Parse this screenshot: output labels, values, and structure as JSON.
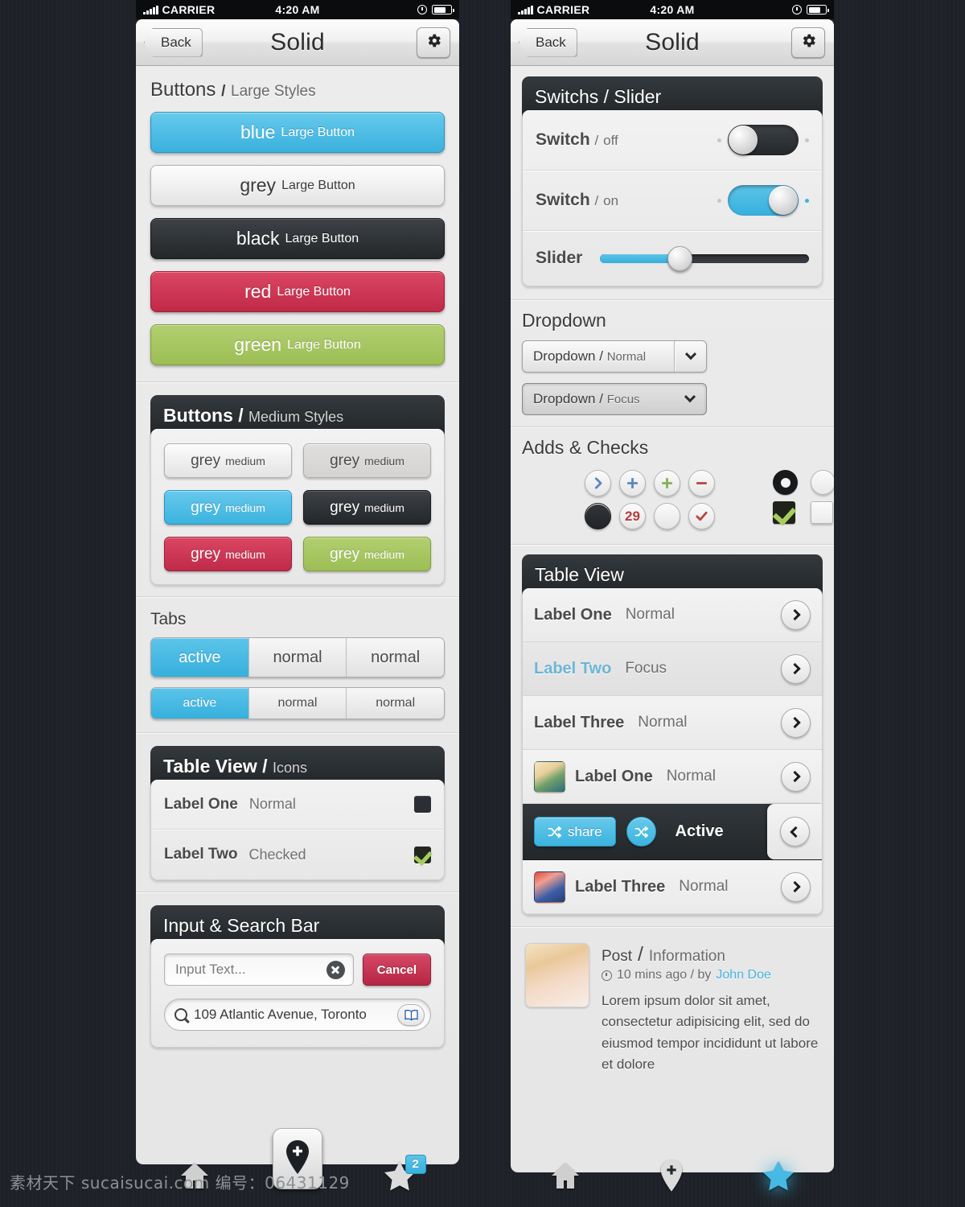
{
  "statusbar": {
    "carrier": "CARRIER",
    "time": "4:20 AM"
  },
  "navbar": {
    "back": "Back",
    "title": "Solid",
    "gear_icon": "gear-icon"
  },
  "left": {
    "buttons_large": {
      "heading_main": "Buttons",
      "heading_sep": "/",
      "heading_sub": "Large Styles",
      "items": [
        {
          "color_word": "blue",
          "label": "Large Button",
          "accent": "#39b1dd"
        },
        {
          "color_word": "grey",
          "label": "Large Button",
          "accent": "#e4e4e4"
        },
        {
          "color_word": "black",
          "label": "Large Button",
          "accent": "#242729"
        },
        {
          "color_word": "red",
          "label": "Large Button",
          "accent": "#c02a48"
        },
        {
          "color_word": "green",
          "label": "Large Button",
          "accent": "#9cbe55"
        }
      ]
    },
    "buttons_medium": {
      "heading_main": "Buttons",
      "heading_sep": "/",
      "heading_sub": "Medium Styles",
      "items": [
        {
          "color_word": "grey",
          "label": "medium"
        },
        {
          "color_word": "grey",
          "label": "medium"
        },
        {
          "color_word": "grey",
          "label": "medium"
        },
        {
          "color_word": "grey",
          "label": "medium"
        },
        {
          "color_word": "grey",
          "label": "medium"
        },
        {
          "color_word": "grey",
          "label": "medium"
        }
      ]
    },
    "tabs": {
      "heading": "Tabs",
      "row1": [
        "active",
        "normal",
        "normal"
      ],
      "row2": [
        "active",
        "normal",
        "normal"
      ]
    },
    "table_icons": {
      "heading_main": "Table View",
      "heading_sep": "/",
      "heading_sub": "Icons",
      "rows": [
        {
          "label": "Label One",
          "value": "Normal",
          "icon": "square-dark-icon"
        },
        {
          "label": "Label Two",
          "value": "Checked",
          "icon": "checkbox-checked-icon"
        }
      ]
    },
    "input_search": {
      "heading": "Input & Search Bar",
      "input_placeholder": "Input Text...",
      "clear_icon": "clear-circle-icon",
      "cancel_label": "Cancel",
      "search_value": "109 Atlantic Avenue, Toronto",
      "search_icon": "search-icon",
      "book_icon": "bookmark-book-icon"
    },
    "tabbar": [
      {
        "icon": "home-icon",
        "badge": ""
      },
      {
        "icon": "pin-plus-icon",
        "badge": ""
      },
      {
        "icon": "star-icon",
        "badge": "2"
      }
    ]
  },
  "right": {
    "switches": {
      "heading": "Switchs / Slider",
      "rows": [
        {
          "label": "Switch",
          "sep": "/",
          "state": "off"
        },
        {
          "label": "Switch",
          "sep": "/",
          "state": "on"
        }
      ],
      "slider_label": "Slider",
      "slider_percent": 38
    },
    "dropdown": {
      "heading": "Dropdown",
      "items": [
        {
          "label": "Dropdown",
          "sep": "/",
          "state": "Normal"
        },
        {
          "label": "Dropdown",
          "sep": "/",
          "state": "Focus"
        }
      ]
    },
    "adds_checks": {
      "heading": "Adds & Checks",
      "left_icons": [
        "chevron-right-circle-icon",
        "plus-blue-circle-icon",
        "plus-green-circle-icon",
        "minus-red-circle-icon",
        "solid-dark-circle-icon",
        "badge-29-icon",
        "empty-circle-icon",
        "check-red-circle-icon"
      ],
      "badge_number": "29",
      "right_icons": [
        "radio-selected-icon",
        "radio-unselected-icon",
        "checkbox-checked-icon",
        "checkbox-unchecked-icon"
      ]
    },
    "table_view": {
      "heading": "Table View",
      "rows": [
        {
          "label": "Label One",
          "value": "Normal",
          "state": "normal",
          "avatar": false,
          "arrow": "right"
        },
        {
          "label": "Label Two",
          "value": "Focus",
          "state": "focus",
          "avatar": false,
          "arrow": "right"
        },
        {
          "label": "Label Three",
          "value": "Normal",
          "state": "normal",
          "avatar": false,
          "arrow": "right"
        },
        {
          "label": "Label One",
          "value": "Normal",
          "state": "normal",
          "avatar": true,
          "arrow": "right"
        },
        {
          "label": "Active",
          "value": "",
          "state": "active",
          "avatar": false,
          "arrow": "left",
          "share_label": "share"
        },
        {
          "label": "Label Three",
          "value": "Normal",
          "state": "normal",
          "avatar": true,
          "arrow": "right"
        }
      ]
    },
    "post": {
      "title_main": "Post",
      "title_sep": "/",
      "title_sub": "Information",
      "meta_time": "10 mins ago / by",
      "meta_author": "John Doe",
      "body": "Lorem ipsum dolor sit amet, consectetur adipisicing elit, sed do eiusmod tempor incididunt ut labore et dolore"
    },
    "tabbar": [
      {
        "icon": "home-icon",
        "active": false
      },
      {
        "icon": "pin-plus-icon",
        "active": false
      },
      {
        "icon": "star-icon",
        "active": true
      }
    ]
  },
  "watermark": "素材天下 sucaisucai.com  编号：06431129"
}
